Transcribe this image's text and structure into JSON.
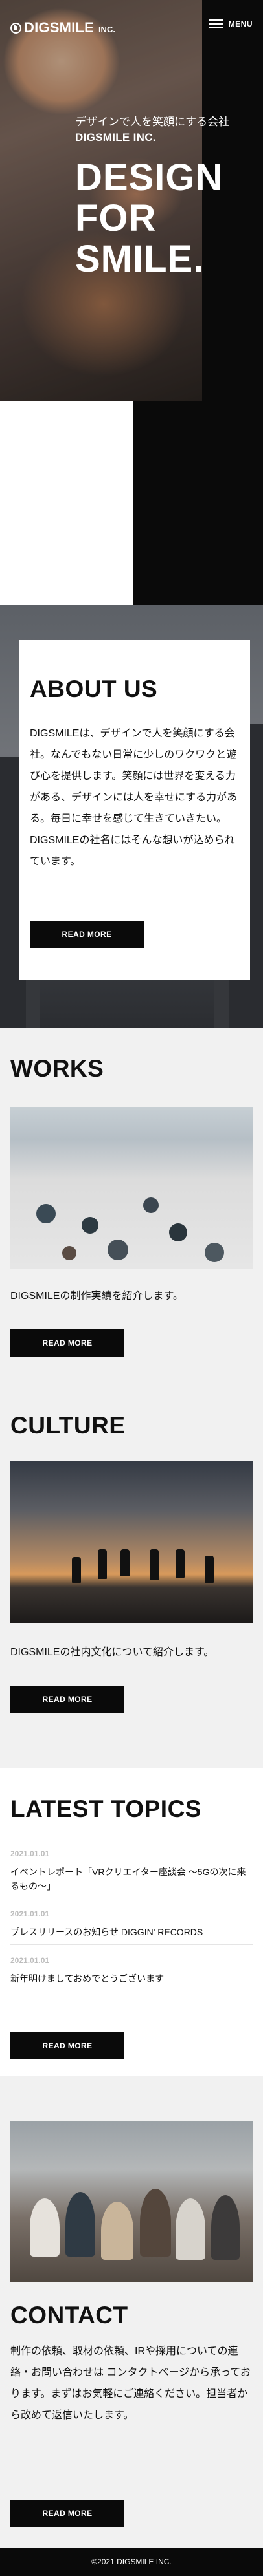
{
  "header": {
    "logo_text": "DIGSMILE",
    "logo_suffix": "INC.",
    "menu_label": "MENU"
  },
  "hero": {
    "tagline": "デザインで人を笑顔にする会社",
    "company": "DIGSMILE INC.",
    "headline_lines": [
      "DESIGN",
      "FOR",
      "SMILE."
    ]
  },
  "about": {
    "title": "ABOUT US",
    "text": "DIGSMILEは、デザインで人を笑顔にする会社。なんでもない日常に少しのワクワクと遊び心を提供します。笑顔には世界を変える力がある、デザインには人を幸せにする力がある。毎日に幸せを感じて生きていきたい。 DIGSMILEの社名にはそんな想いが込められています。",
    "button": "READ MORE"
  },
  "works": {
    "title": "WORKS",
    "desc": "DIGSMILEの制作実績を紹介します。",
    "button": "READ MORE"
  },
  "culture": {
    "title": "CULTURE",
    "desc": "DIGSMILEの社内文化について紹介します。",
    "button": "READ MORE"
  },
  "topics": {
    "title": "LATEST TOPICS",
    "items": [
      {
        "date": "2021.01.01",
        "text": "イベントレポート「VRクリエイター座談会 〜5Gの次に来るもの〜」"
      },
      {
        "date": "2021.01.01",
        "text": "プレスリリースのお知らせ DIGGIN' RECORDS"
      },
      {
        "date": "2021.01.01",
        "text": "新年明けましておめでとうございます"
      }
    ],
    "button": "READ MORE"
  },
  "contact": {
    "title": "CONTACT",
    "text": "制作の依頼、取材の依頼、IRや採用についての連絡・お問い合わせは コンタクトページから承っております。まずはお気軽にご連絡ください。担当者から改めて返信いたします。",
    "button": "READ MORE"
  },
  "footer": {
    "copyright": "©2021 DIGSMILE INC."
  },
  "colors": {
    "black": "#0a0a0a",
    "light_gray_bg": "#f1f1f1",
    "date_gray": "#bdbdbd"
  }
}
